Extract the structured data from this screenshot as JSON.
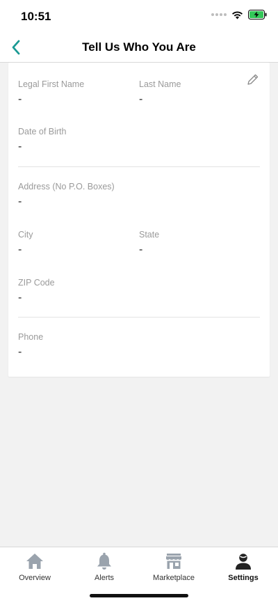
{
  "status_bar": {
    "time": "10:51",
    "icons": [
      "signal-dots-icon",
      "wifi-icon",
      "battery-charging-icon"
    ]
  },
  "nav": {
    "title": "Tell Us Who You Are",
    "back_icon": "chevron-left-icon",
    "accent_color": "#1a9a94"
  },
  "card": {
    "edit_icon": "pencil-icon",
    "fields": {
      "first_name": {
        "label": "Legal First Name",
        "value": "-"
      },
      "last_name": {
        "label": "Last Name",
        "value": "-"
      },
      "dob": {
        "label": "Date of Birth",
        "value": "-"
      },
      "address": {
        "label": "Address (No P.O. Boxes)",
        "value": "-"
      },
      "city": {
        "label": "City",
        "value": "-"
      },
      "state": {
        "label": "State",
        "value": "-"
      },
      "zip": {
        "label": "ZIP Code",
        "value": "-"
      },
      "phone": {
        "label": "Phone",
        "value": "-"
      }
    }
  },
  "tabs": [
    {
      "label": "Overview",
      "icon": "home-icon",
      "active": false
    },
    {
      "label": "Alerts",
      "icon": "bell-icon",
      "active": false
    },
    {
      "label": "Marketplace",
      "icon": "store-icon",
      "active": false
    },
    {
      "label": "Settings",
      "icon": "user-settings-icon",
      "active": true
    }
  ],
  "colors": {
    "inactive_icon": "#9aa3ad",
    "active_icon": "#222222",
    "battery": "#34c759"
  }
}
